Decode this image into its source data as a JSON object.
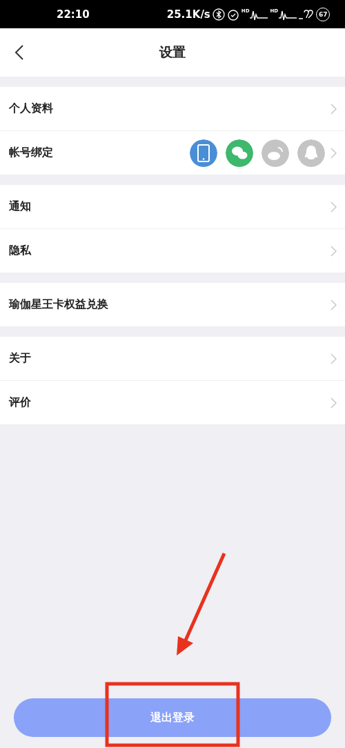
{
  "status_bar": {
    "time": "22:10",
    "speed": "25.1K/s",
    "signals": [
      {
        "label": "HD"
      },
      {
        "label": "HD"
      }
    ],
    "battery": "67"
  },
  "header": {
    "title": "设置"
  },
  "groups": [
    {
      "rows": [
        {
          "label": "个人资料"
        },
        {
          "label": "帐号绑定",
          "accounts": [
            {
              "kind": "phone",
              "bound": true
            },
            {
              "kind": "wechat",
              "bound": true
            },
            {
              "kind": "weibo",
              "bound": false
            },
            {
              "kind": "qq",
              "bound": false
            }
          ]
        }
      ]
    },
    {
      "rows": [
        {
          "label": "通知"
        },
        {
          "label": "隐私"
        }
      ]
    },
    {
      "rows": [
        {
          "label": "瑜伽星王卡权益兑换"
        }
      ]
    },
    {
      "rows": [
        {
          "label": "关于"
        },
        {
          "label": "评价"
        }
      ]
    }
  ],
  "logout_button": {
    "label": "退出登录"
  }
}
